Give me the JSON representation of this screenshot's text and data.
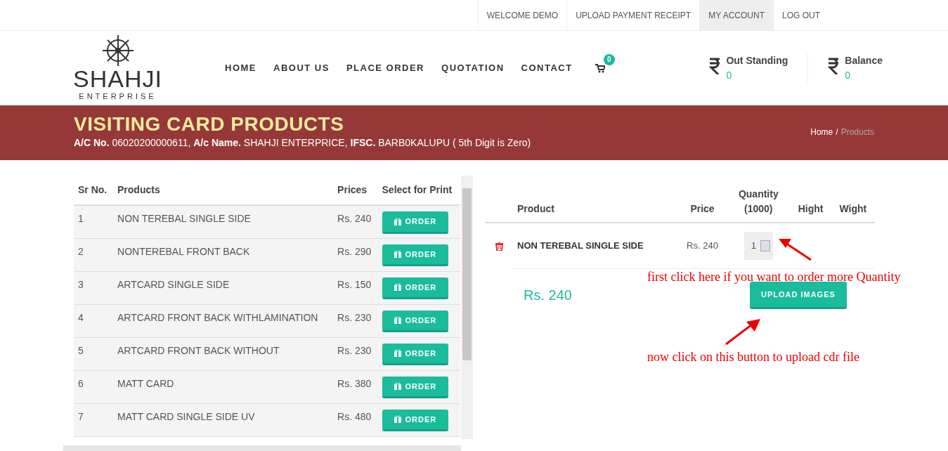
{
  "top_links": [
    {
      "label": "WELCOME DEMO",
      "selected": false
    },
    {
      "label": "UPLOAD PAYMENT RECEIPT",
      "selected": false
    },
    {
      "label": "MY ACCOUNT",
      "selected": true
    },
    {
      "label": "LOG OUT",
      "selected": false
    }
  ],
  "logo": {
    "name": "SHAHJI",
    "tagline": "ENTERPRISE"
  },
  "nav": [
    "HOME",
    "ABOUT US",
    "PLACE ORDER",
    "QUOTATION",
    "CONTACT"
  ],
  "cart_count": "0",
  "stats": [
    {
      "label": "Out Standing",
      "value": "0"
    },
    {
      "label": "Balance",
      "value": "0"
    }
  ],
  "banner": {
    "title": "VISITING CARD PRODUCTS",
    "account_line": "**A/C No.** 06020200000611, **A/c Name.** SHAHJI ENTERPRICE, **IFSC.** BARB0KALUPU ( 5th Digit is Zero)",
    "breadcrumb": [
      {
        "label": "Home",
        "selected": false
      },
      {
        "label": "Products",
        "selected": true
      }
    ],
    "breadcrumb_separator": "/"
  },
  "products": {
    "columns": [
      "Sr No.",
      "Products",
      "Prices",
      "Select for Print"
    ],
    "rows": [
      {
        "cells": [
          "1",
          "NON TEREBAL SINGLE SIDE",
          "Rs. 240"
        ],
        "button": "ORDER"
      },
      {
        "cells": [
          "2",
          "NONTEREBAL FRONT BACK",
          "Rs. 290"
        ],
        "button": "ORDER"
      },
      {
        "cells": [
          "3",
          "ARTCARD SINGLE SIDE",
          "Rs. 150"
        ],
        "button": "ORDER"
      },
      {
        "cells": [
          "4",
          "ARTCARD FRONT BACK WITHLAMINATION",
          "Rs. 230"
        ],
        "button": "ORDER"
      },
      {
        "cells": [
          "5",
          "ARTCARD FRONT BACK WITHOUT",
          "Rs. 230"
        ],
        "button": "ORDER"
      },
      {
        "cells": [
          "6",
          "MATT CARD",
          "Rs. 380"
        ],
        "button": "ORDER"
      },
      {
        "cells": [
          "7",
          "MATT CARD SINGLE SIDE UV",
          "Rs. 480"
        ],
        "button": "ORDER"
      }
    ]
  },
  "cart": {
    "columns": [
      "Product",
      "Price",
      "Quantity (1000)",
      "Hight",
      "Wight"
    ],
    "rows": [
      {
        "product": "NON TEREBAL SINGLE SIDE",
        "price": "Rs. 240",
        "quantity": "1"
      }
    ],
    "total": "Rs. 240",
    "upload_button": "UPLOAD IMAGES"
  },
  "annotations": [
    "first click here if you want to order more Quantity",
    "now click on this button to upload cdr file"
  ]
}
